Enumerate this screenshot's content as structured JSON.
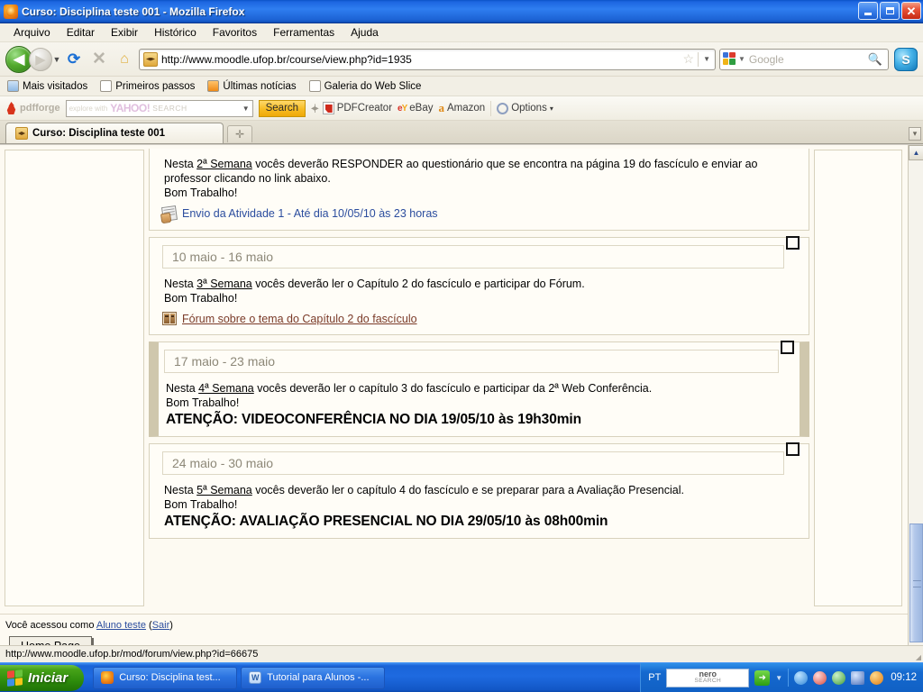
{
  "window": {
    "title": "Curso: Disciplina teste 001 - Mozilla Firefox",
    "icon": "firefox-icon",
    "minimize_label": "Minimizar",
    "restore_label": "Restaurar",
    "close_label": "Fechar"
  },
  "menubar": {
    "items": [
      {
        "label": "Arquivo",
        "accel": "A"
      },
      {
        "label": "Editar",
        "accel": "E"
      },
      {
        "label": "Exibir",
        "accel": "x"
      },
      {
        "label": "Histórico",
        "accel": "H"
      },
      {
        "label": "Favoritos",
        "accel": "v"
      },
      {
        "label": "Ferramentas",
        "accel": "F"
      },
      {
        "label": "Ajuda",
        "accel": "u"
      }
    ]
  },
  "navbar": {
    "back_icon": "back-arrow-icon",
    "forward_icon": "forward-arrow-icon",
    "history_dropdown_icon": "chevron-down-icon",
    "reload_icon": "reload-icon",
    "stop_icon": "stop-icon",
    "home_icon": "home-icon",
    "url": "http://www.moodle.ufop.br/course/view.php?id=1935",
    "favicon": "moodle-graduation-cap-icon",
    "bookmark_star_icon": "star-icon",
    "url_dropdown_icon": "chevron-down-icon",
    "search_placeholder": "Google",
    "search_engine_icon": "google-icon",
    "search_magnifier_icon": "search-icon",
    "skype_icon": "skype-icon"
  },
  "bookmarks": [
    {
      "label": "Mais visitados",
      "icon": "most-visited-icon"
    },
    {
      "label": "Primeiros passos",
      "icon": "page-icon"
    },
    {
      "label": "Últimas notícias",
      "icon": "rss-icon"
    },
    {
      "label": "Galeria do Web Slice",
      "icon": "page-icon"
    }
  ],
  "pdfforge_toolbar": {
    "brand": "pdfforge",
    "brand_icon": "pdfforge-flame-icon",
    "yahoo_explore": "explore with",
    "yahoo_logo": "YAHOO!",
    "yahoo_search_word": "SEARCH",
    "yahoo_dropdown_icon": "chevron-down-icon",
    "search_button": "Search",
    "items": [
      {
        "label": "PDFCreator",
        "icon": "pdf-icon"
      },
      {
        "label": "eBay",
        "icon": "ebay-icon"
      },
      {
        "label": "Amazon",
        "icon": "amazon-icon"
      },
      {
        "label": "Options",
        "icon": "options-icon"
      }
    ]
  },
  "tabs": {
    "active": {
      "label": "Curso: Disciplina teste 001",
      "icon": "moodle-graduation-cap-icon"
    },
    "new_tab_icon": "new-tab-icon",
    "list_all_icon": "list-all-tabs-icon"
  },
  "page": {
    "weeks": [
      {
        "partial": true,
        "highlighted": false,
        "date_range": "",
        "lines": [
          "Nesta 2ª Semana vocês deverão RESPONDER ao questionário que se encontra na página 19 do fascículo e enviar ao",
          "professor clicando no link abaixo.",
          "Bom Trabalho!"
        ],
        "underline_token": "2ª Semana",
        "notice": "",
        "activity": {
          "label": "Envio da Atividade 1 - Até dia 10/05/10 às 23 horas",
          "icon": "assignment-icon",
          "visited": false
        }
      },
      {
        "partial": false,
        "highlighted": false,
        "date_range": "10 maio - 16 maio",
        "lines": [
          "Nesta 3ª Semana vocês deverão ler o Capítulo 2 do fascículo e participar do Fórum.",
          "Bom Trabalho!"
        ],
        "underline_token": "3ª Semana",
        "notice": "",
        "activity": {
          "label": "Fórum sobre o tema do Capítulo 2 do fascículo",
          "icon": "forum-icon",
          "visited": true
        }
      },
      {
        "partial": false,
        "highlighted": true,
        "date_range": "17 maio - 23 maio",
        "lines": [
          "Nesta 4ª Semana vocês deverão ler o capítulo 3 do fascículo e participar da 2ª Web Conferência.",
          "Bom Trabalho!"
        ],
        "underline_token": "4ª Semana",
        "notice": "ATENÇÃO: VIDEOCONFERÊNCIA NO DIA 19/05/10 às 19h30min",
        "activity": null
      },
      {
        "partial": false,
        "highlighted": false,
        "date_range": "24 maio - 30 maio",
        "lines": [
          "Nesta 5ª Semana vocês deverão ler o capítulo 4 do fascículo e se preparar para a Avaliação Presencial.",
          "Bom Trabalho!"
        ],
        "underline_token": "5ª Semana",
        "notice": "ATENÇÃO: AVALIAÇÃO PRESENCIAL NO DIA 29/05/10 às 08h00min",
        "activity": null
      }
    ],
    "checkbox_icon": "week-checkbox",
    "footer": {
      "login_prefix": "Você acessou como ",
      "login_user": "Aluno teste",
      "logout_open": " (",
      "logout_label": "Sair",
      "logout_close": ")",
      "home_button": "Home Page"
    }
  },
  "statusbar": {
    "text": "http://www.moodle.ufop.br/mod/forum/view.php?id=66675"
  },
  "scrollbar": {
    "up_icon": "scroll-up-icon",
    "down_icon": "scroll-down-icon",
    "thumb": "scroll-thumb"
  },
  "taskbar": {
    "start_label": "Iniciar",
    "start_icon": "windows-flag-icon",
    "tasks": [
      {
        "label": "Curso: Disciplina test...",
        "icon": "firefox-icon"
      },
      {
        "label": "Tutorial para Alunos -...",
        "icon": "word-icon"
      }
    ],
    "tray": {
      "language": "PT",
      "nero_line1": "nero",
      "nero_line2": "SEARCH",
      "go_icon": "go-arrow-icon",
      "go_caret_icon": "chevron-down-icon",
      "icons": [
        "back-icon",
        "antivirus-icon",
        "sync-icon",
        "network-icon",
        "update-icon"
      ],
      "clock": "09:12"
    }
  },
  "colors": {
    "titlebar_blue": "#1c66e0",
    "chrome_beige": "#f2efe5",
    "page_bg": "#fdfaf2",
    "week_border": "#d8d2bd",
    "current_week_band": "#cfc7ad",
    "link_blue": "#2b4d9e",
    "link_visited": "#7a3a28",
    "taskbar_blue": "#1a64d8",
    "start_green": "#46a318"
  }
}
